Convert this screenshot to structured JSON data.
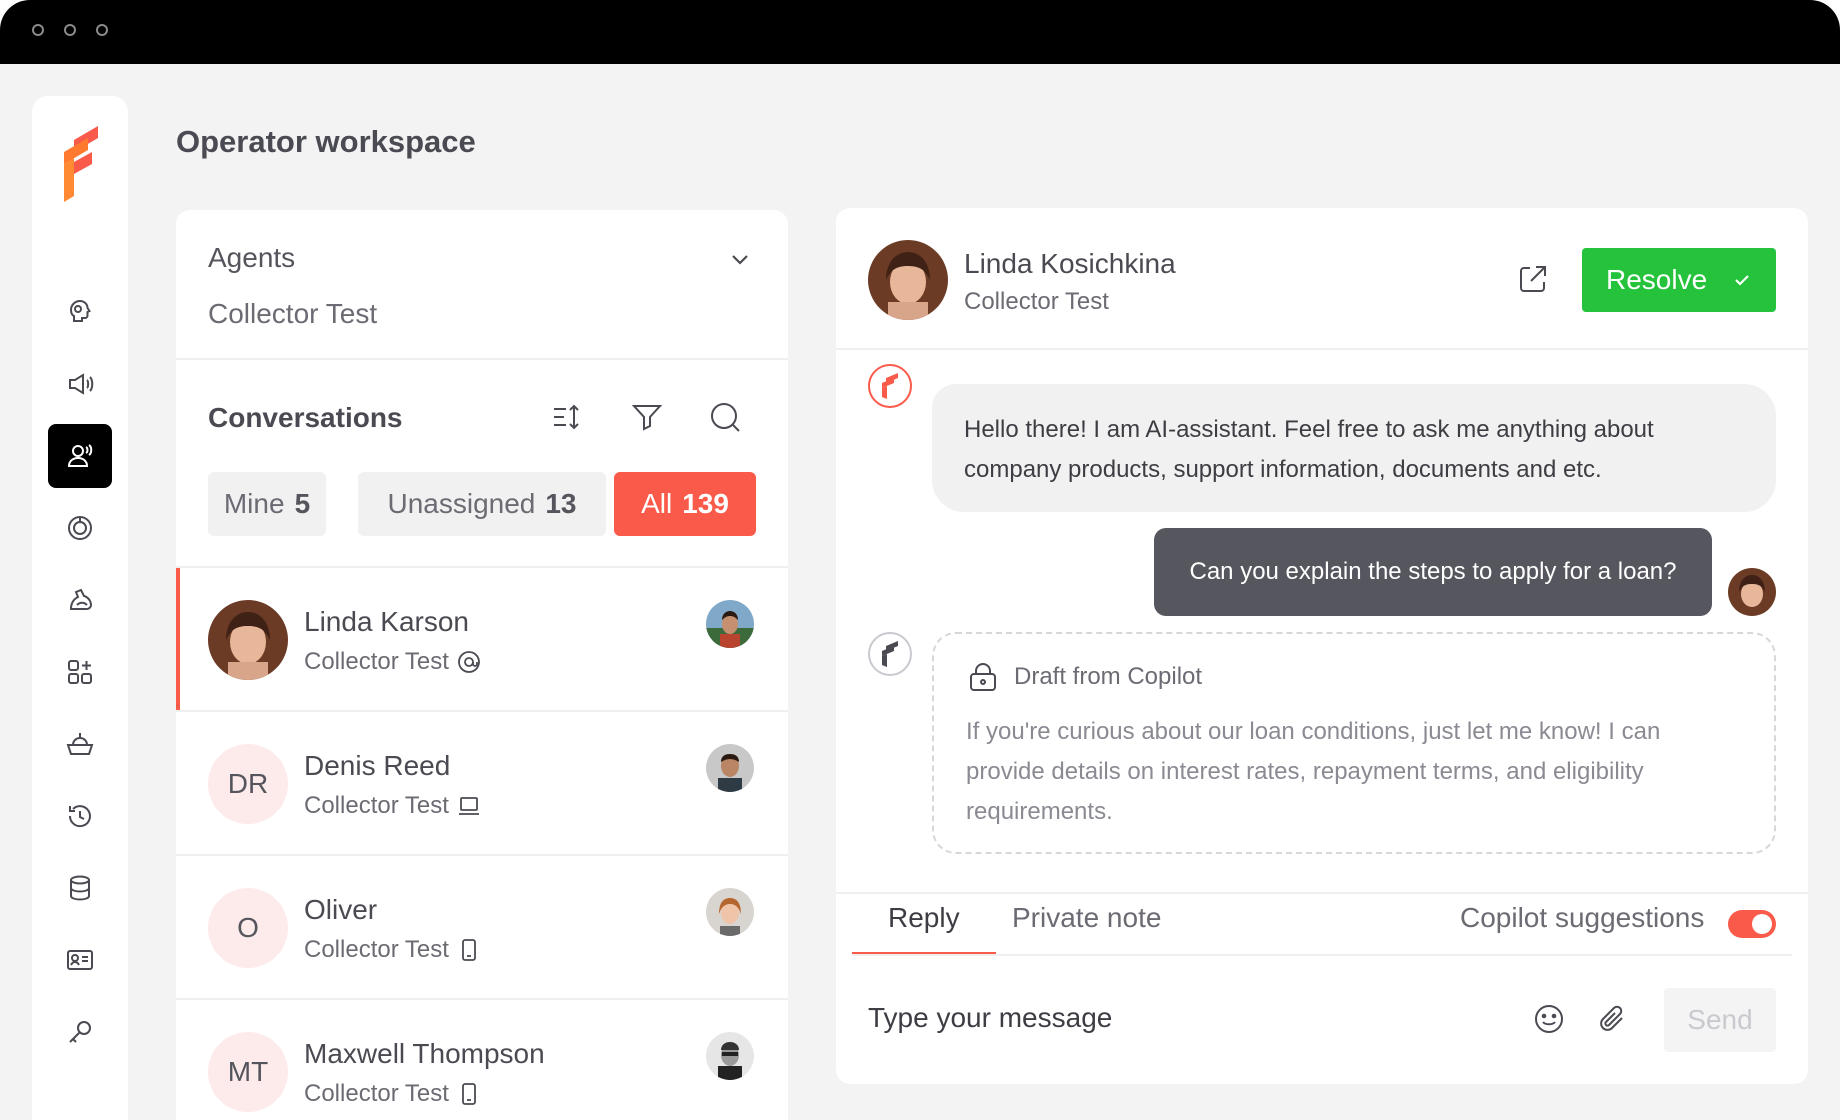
{
  "page_title": "Operator workspace",
  "colors": {
    "accent": "#fa5a4a",
    "resolve": "#24c33b",
    "active_nav": "#000000"
  },
  "sidebar": {
    "items": [
      {
        "icon": "brain-icon"
      },
      {
        "icon": "megaphone-icon"
      },
      {
        "icon": "operator-icon",
        "active": true
      },
      {
        "icon": "analytics-icon"
      },
      {
        "icon": "muscle-icon"
      },
      {
        "icon": "apps-add-icon"
      },
      {
        "icon": "bowl-icon"
      },
      {
        "icon": "history-icon"
      },
      {
        "icon": "database-icon"
      },
      {
        "icon": "contact-card-icon"
      },
      {
        "icon": "key-icon"
      }
    ]
  },
  "agents": {
    "label": "Agents",
    "value": "Collector Test"
  },
  "conversations": {
    "title": "Conversations",
    "tabs": [
      {
        "label": "Mine",
        "count": "5"
      },
      {
        "label": "Unassigned",
        "count": "13"
      },
      {
        "label": "All",
        "count": "139",
        "active": true
      }
    ],
    "items": [
      {
        "name": "Linda Karson",
        "sub": "Collector Test",
        "channel": "at-sign-icon",
        "initials": ""
      },
      {
        "name": "Denis Reed",
        "sub": "Collector Test",
        "channel": "laptop-icon",
        "initials": "DR"
      },
      {
        "name": "Oliver",
        "sub": "Collector Test",
        "channel": "phone-icon",
        "initials": "O"
      },
      {
        "name": "Maxwell Thompson",
        "sub": "Collector Test",
        "channel": "phone-icon",
        "initials": "MT"
      }
    ]
  },
  "chat": {
    "name": "Linda Kosichkina",
    "sub": "Collector Test",
    "resolve_label": "Resolve",
    "bot_message": "Hello there! I am AI-assistant. Feel free to ask me anything about company products, support information, documents and etc.",
    "user_message": "Can you explain the steps to apply for a loan?",
    "draft_title": "Draft from Copilot",
    "draft_text": "If you're curious about our loan conditions, just let me know! I can provide details on interest rates, repayment terms, and eligibility requirements.",
    "reply_tab": "Reply",
    "private_tab": "Private note",
    "copilot_label": "Copilot suggestions",
    "copilot_enabled": true,
    "input_placeholder": "Type your message",
    "send_label": "Send"
  }
}
